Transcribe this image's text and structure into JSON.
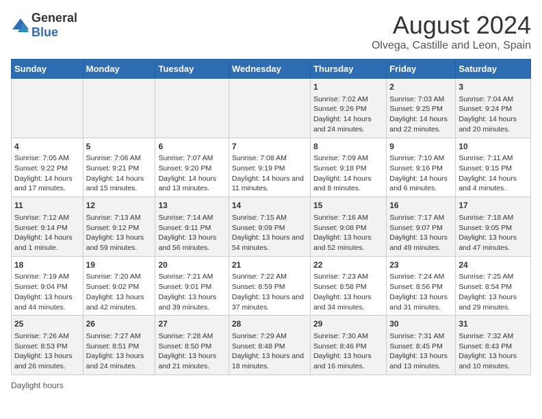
{
  "logo": {
    "general": "General",
    "blue": "Blue"
  },
  "title": "August 2024",
  "subtitle": "Olvega, Castille and Leon, Spain",
  "days_of_week": [
    "Sunday",
    "Monday",
    "Tuesday",
    "Wednesday",
    "Thursday",
    "Friday",
    "Saturday"
  ],
  "weeks": [
    [
      {
        "day": "",
        "sunrise": "",
        "sunset": "",
        "daylight": ""
      },
      {
        "day": "",
        "sunrise": "",
        "sunset": "",
        "daylight": ""
      },
      {
        "day": "",
        "sunrise": "",
        "sunset": "",
        "daylight": ""
      },
      {
        "day": "",
        "sunrise": "",
        "sunset": "",
        "daylight": ""
      },
      {
        "day": "1",
        "sunrise": "Sunrise: 7:02 AM",
        "sunset": "Sunset: 9:26 PM",
        "daylight": "Daylight: 14 hours and 24 minutes."
      },
      {
        "day": "2",
        "sunrise": "Sunrise: 7:03 AM",
        "sunset": "Sunset: 9:25 PM",
        "daylight": "Daylight: 14 hours and 22 minutes."
      },
      {
        "day": "3",
        "sunrise": "Sunrise: 7:04 AM",
        "sunset": "Sunset: 9:24 PM",
        "daylight": "Daylight: 14 hours and 20 minutes."
      }
    ],
    [
      {
        "day": "4",
        "sunrise": "Sunrise: 7:05 AM",
        "sunset": "Sunset: 9:22 PM",
        "daylight": "Daylight: 14 hours and 17 minutes."
      },
      {
        "day": "5",
        "sunrise": "Sunrise: 7:06 AM",
        "sunset": "Sunset: 9:21 PM",
        "daylight": "Daylight: 14 hours and 15 minutes."
      },
      {
        "day": "6",
        "sunrise": "Sunrise: 7:07 AM",
        "sunset": "Sunset: 9:20 PM",
        "daylight": "Daylight: 14 hours and 13 minutes."
      },
      {
        "day": "7",
        "sunrise": "Sunrise: 7:08 AM",
        "sunset": "Sunset: 9:19 PM",
        "daylight": "Daylight: 14 hours and 11 minutes."
      },
      {
        "day": "8",
        "sunrise": "Sunrise: 7:09 AM",
        "sunset": "Sunset: 9:18 PM",
        "daylight": "Daylight: 14 hours and 8 minutes."
      },
      {
        "day": "9",
        "sunrise": "Sunrise: 7:10 AM",
        "sunset": "Sunset: 9:16 PM",
        "daylight": "Daylight: 14 hours and 6 minutes."
      },
      {
        "day": "10",
        "sunrise": "Sunrise: 7:11 AM",
        "sunset": "Sunset: 9:15 PM",
        "daylight": "Daylight: 14 hours and 4 minutes."
      }
    ],
    [
      {
        "day": "11",
        "sunrise": "Sunrise: 7:12 AM",
        "sunset": "Sunset: 9:14 PM",
        "daylight": "Daylight: 14 hours and 1 minute."
      },
      {
        "day": "12",
        "sunrise": "Sunrise: 7:13 AM",
        "sunset": "Sunset: 9:12 PM",
        "daylight": "Daylight: 13 hours and 59 minutes."
      },
      {
        "day": "13",
        "sunrise": "Sunrise: 7:14 AM",
        "sunset": "Sunset: 9:11 PM",
        "daylight": "Daylight: 13 hours and 56 minutes."
      },
      {
        "day": "14",
        "sunrise": "Sunrise: 7:15 AM",
        "sunset": "Sunset: 9:09 PM",
        "daylight": "Daylight: 13 hours and 54 minutes."
      },
      {
        "day": "15",
        "sunrise": "Sunrise: 7:16 AM",
        "sunset": "Sunset: 9:08 PM",
        "daylight": "Daylight: 13 hours and 52 minutes."
      },
      {
        "day": "16",
        "sunrise": "Sunrise: 7:17 AM",
        "sunset": "Sunset: 9:07 PM",
        "daylight": "Daylight: 13 hours and 49 minutes."
      },
      {
        "day": "17",
        "sunrise": "Sunrise: 7:18 AM",
        "sunset": "Sunset: 9:05 PM",
        "daylight": "Daylight: 13 hours and 47 minutes."
      }
    ],
    [
      {
        "day": "18",
        "sunrise": "Sunrise: 7:19 AM",
        "sunset": "Sunset: 9:04 PM",
        "daylight": "Daylight: 13 hours and 44 minutes."
      },
      {
        "day": "19",
        "sunrise": "Sunrise: 7:20 AM",
        "sunset": "Sunset: 9:02 PM",
        "daylight": "Daylight: 13 hours and 42 minutes."
      },
      {
        "day": "20",
        "sunrise": "Sunrise: 7:21 AM",
        "sunset": "Sunset: 9:01 PM",
        "daylight": "Daylight: 13 hours and 39 minutes."
      },
      {
        "day": "21",
        "sunrise": "Sunrise: 7:22 AM",
        "sunset": "Sunset: 8:59 PM",
        "daylight": "Daylight: 13 hours and 37 minutes."
      },
      {
        "day": "22",
        "sunrise": "Sunrise: 7:23 AM",
        "sunset": "Sunset: 8:58 PM",
        "daylight": "Daylight: 13 hours and 34 minutes."
      },
      {
        "day": "23",
        "sunrise": "Sunrise: 7:24 AM",
        "sunset": "Sunset: 8:56 PM",
        "daylight": "Daylight: 13 hours and 31 minutes."
      },
      {
        "day": "24",
        "sunrise": "Sunrise: 7:25 AM",
        "sunset": "Sunset: 8:54 PM",
        "daylight": "Daylight: 13 hours and 29 minutes."
      }
    ],
    [
      {
        "day": "25",
        "sunrise": "Sunrise: 7:26 AM",
        "sunset": "Sunset: 8:53 PM",
        "daylight": "Daylight: 13 hours and 26 minutes."
      },
      {
        "day": "26",
        "sunrise": "Sunrise: 7:27 AM",
        "sunset": "Sunset: 8:51 PM",
        "daylight": "Daylight: 13 hours and 24 minutes."
      },
      {
        "day": "27",
        "sunrise": "Sunrise: 7:28 AM",
        "sunset": "Sunset: 8:50 PM",
        "daylight": "Daylight: 13 hours and 21 minutes."
      },
      {
        "day": "28",
        "sunrise": "Sunrise: 7:29 AM",
        "sunset": "Sunset: 8:48 PM",
        "daylight": "Daylight: 13 hours and 18 minutes."
      },
      {
        "day": "29",
        "sunrise": "Sunrise: 7:30 AM",
        "sunset": "Sunset: 8:46 PM",
        "daylight": "Daylight: 13 hours and 16 minutes."
      },
      {
        "day": "30",
        "sunrise": "Sunrise: 7:31 AM",
        "sunset": "Sunset: 8:45 PM",
        "daylight": "Daylight: 13 hours and 13 minutes."
      },
      {
        "day": "31",
        "sunrise": "Sunrise: 7:32 AM",
        "sunset": "Sunset: 8:43 PM",
        "daylight": "Daylight: 13 hours and 10 minutes."
      }
    ]
  ],
  "footer": "Daylight hours"
}
